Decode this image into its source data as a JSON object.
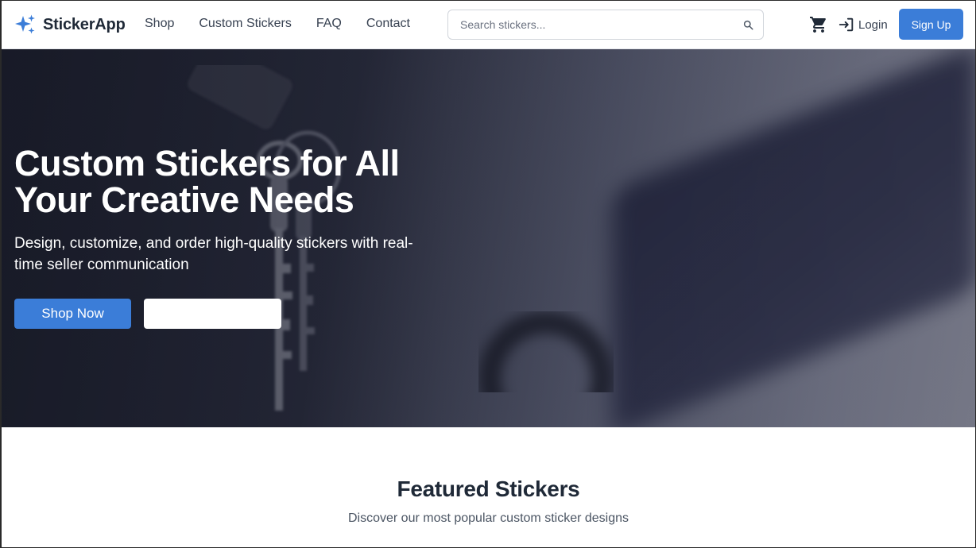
{
  "brand": {
    "name": "StickerApp",
    "icon": "sparkles-icon",
    "color": "#3b7dd8"
  },
  "nav": {
    "links": [
      "Shop",
      "Custom Stickers",
      "FAQ",
      "Contact"
    ],
    "search_placeholder": "Search stickers...",
    "cart_icon": "cart-icon",
    "login_label": "Login",
    "signup_label": "Sign Up"
  },
  "hero": {
    "title": "Custom Stickers for All Your Creative Needs",
    "subtitle": "Design, customize, and order high-quality stickers with real-time seller communication",
    "primary_button": "Shop Now",
    "secondary_button": ""
  },
  "featured": {
    "title": "Featured Stickers",
    "subtitle": "Discover our most popular custom sticker designs"
  },
  "colors": {
    "accent": "#3b7dd8",
    "text_dark": "#1f2937"
  }
}
